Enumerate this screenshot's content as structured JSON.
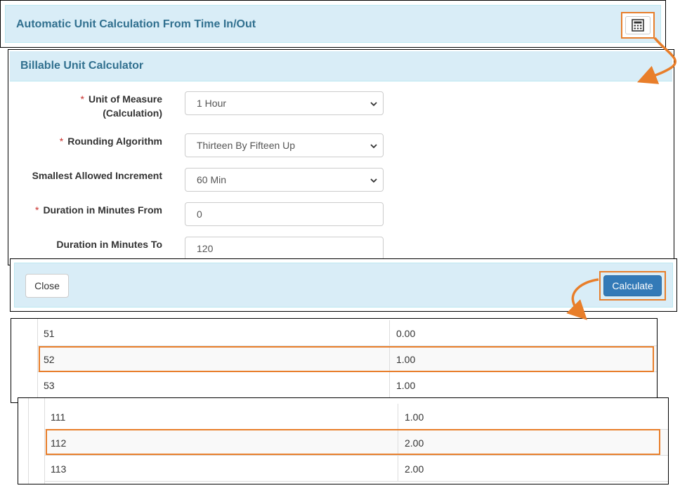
{
  "panel_top": {
    "title": "Automatic Unit Calculation From Time In/Out",
    "calculator_icon": "calculator-icon"
  },
  "calculator": {
    "title": "Billable Unit Calculator",
    "fields": [
      {
        "label": "Unit of Measure",
        "label2": "(Calculation)",
        "required": true,
        "type": "select",
        "value": "1 Hour"
      },
      {
        "label": "Rounding Algorithm",
        "required": true,
        "type": "select",
        "value": "Thirteen By Fifteen Up"
      },
      {
        "label": "Smallest Allowed Increment",
        "required": false,
        "type": "select",
        "value": "60 Min"
      },
      {
        "label": "Duration in Minutes From",
        "required": true,
        "type": "input",
        "value": "0"
      },
      {
        "label": "Duration in Minutes To",
        "required": false,
        "type": "input",
        "value": "120"
      }
    ],
    "required_mark": "*",
    "chevron_icon": "chevron-down-icon"
  },
  "footer": {
    "close_label": "Close",
    "calculate_label": "Calculate"
  },
  "results_a": [
    {
      "minutes": "51",
      "units": "0.00",
      "highlighted": false
    },
    {
      "minutes": "52",
      "units": "1.00",
      "highlighted": true
    },
    {
      "minutes": "53",
      "units": "1.00",
      "highlighted": false
    }
  ],
  "results_b": [
    {
      "minutes": "111",
      "units": "1.00",
      "highlighted": false
    },
    {
      "minutes": "112",
      "units": "2.00",
      "highlighted": true
    },
    {
      "minutes": "113",
      "units": "2.00",
      "highlighted": false
    }
  ],
  "colors": {
    "highlight": "#e87e2a",
    "header_bg": "#d9edf7",
    "header_text": "#31708f",
    "primary": "#337ab7",
    "required": "#c9302c"
  }
}
